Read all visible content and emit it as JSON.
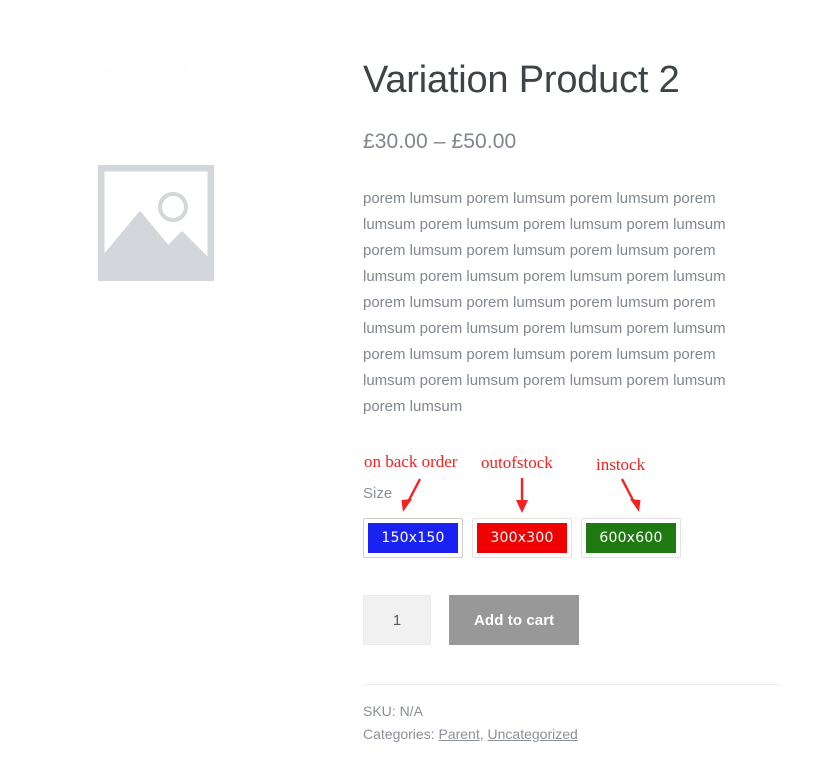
{
  "product": {
    "title": "Variation Product 2",
    "price": "£30.00 – £50.00",
    "description": "porem lumsum porem lumsum porem lumsum porem lumsum porem lumsum porem lumsum porem lumsum porem lumsum porem lumsum porem lumsum porem lumsum porem lumsum porem lumsum porem lumsum porem lumsum porem lumsum porem lumsum porem lumsum porem lumsum porem lumsum porem lumsum porem lumsum porem lumsum porem lumsum porem lumsum porem lumsum porem lumsum porem lumsum porem lumsum"
  },
  "gallery": {
    "placeholder_alt": "Awaiting product image",
    "watermark": "Awaiting product image",
    "watermark_left": "image",
    "watermark_right": "image"
  },
  "variations": {
    "attribute_label": "Size",
    "options": [
      {
        "label": "150x150",
        "color": "#1a22f2",
        "text_color": "#ffffff",
        "selected": true
      },
      {
        "label": "300x300",
        "color": "#f00000",
        "text_color": "#ffffff",
        "selected": false
      },
      {
        "label": "600x600",
        "color": "#1e7a10",
        "text_color": "#ffffff",
        "selected": false
      }
    ]
  },
  "annotations": {
    "color": "#f4211f",
    "items": [
      {
        "label": "on back order",
        "target": "150x150"
      },
      {
        "label": "outofstock",
        "target": "300x300"
      },
      {
        "label": "instock",
        "target": "600x600"
      }
    ]
  },
  "cart": {
    "quantity": "1",
    "quantity_placeholder": "1",
    "add_to_cart_label": "Add to cart",
    "add_to_cart_color": "#989898"
  },
  "meta": {
    "sku_line": "SKU: N/A",
    "categories_label": "Categories:",
    "categories": [
      {
        "name": "Parent"
      },
      {
        "name": "Uncategorized"
      }
    ],
    "categories_separator": ",",
    "categories_trailing": ""
  }
}
